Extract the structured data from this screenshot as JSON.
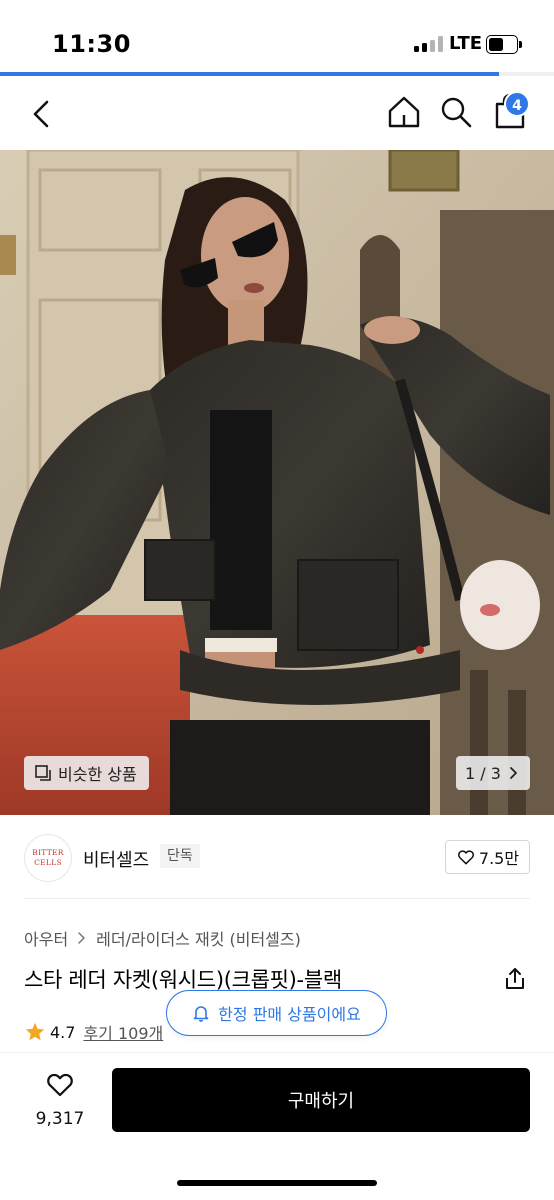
{
  "status_bar": {
    "time": "11:30",
    "network": "LTE",
    "icons": [
      "signal-icon",
      "battery-icon"
    ]
  },
  "page_progress": 0.9,
  "header": {
    "icons": [
      "back-icon",
      "home-icon",
      "search-icon",
      "shopping-bag-icon"
    ],
    "cart_count": "4"
  },
  "gallery": {
    "similar_label": "비슷한 상품",
    "page_indicator": "1 / 3"
  },
  "brand": {
    "logo_line1": "BITTER",
    "logo_line2": "CELLS",
    "name": "비터셀즈",
    "tag": "단독",
    "like_count": "7.5만"
  },
  "breadcrumb": {
    "items": [
      "아우터",
      "레더/라이더스 재킷 (비터셀즈)"
    ]
  },
  "product": {
    "title": "스타 레더 자켓(워시드)(크롭핏)-블랙",
    "rating": "4.7",
    "reviews": "후기 109개",
    "limited_notice": "한정 판매 상품이에요"
  },
  "bottom_bar": {
    "wish_count": "9,317",
    "buy_label": "구매하기"
  },
  "colors": {
    "accent": "#2f78e6",
    "star": "#f5a623",
    "buy_button": "#000000"
  }
}
